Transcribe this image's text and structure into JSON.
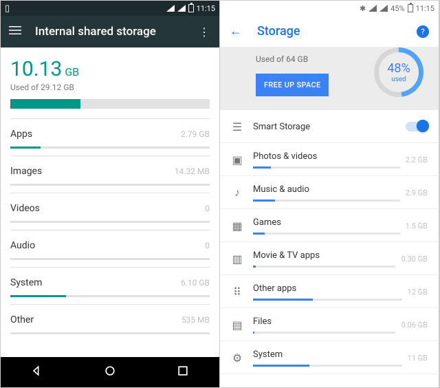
{
  "left": {
    "status_time": "11:15",
    "title": "Internal shared storage",
    "used_value": "10.13",
    "used_unit": "GB",
    "used_sub": "Used of 29.12 GB",
    "total_fill_pct": 35,
    "rows": [
      {
        "label": "Apps",
        "value": "2.79 GB",
        "fill": 15
      },
      {
        "label": "Images",
        "value": "14.32 MB",
        "fill": 0
      },
      {
        "label": "Videos",
        "value": "0",
        "fill": 0
      },
      {
        "label": "Audio",
        "value": "0",
        "fill": 0
      },
      {
        "label": "System",
        "value": "6.10 GB",
        "fill": 28
      },
      {
        "label": "Other",
        "value": "535 MB",
        "fill": 0
      }
    ]
  },
  "right": {
    "status_battery": "45%",
    "status_time": "11:15",
    "title": "Storage",
    "used_sub": "Used of 64 GB",
    "ring_pct": "48%",
    "ring_label": "used",
    "free_button": "FREE UP SPACE",
    "smart_label": "Smart Storage",
    "rows": [
      {
        "label": "Photos & videos",
        "value": "2.2 GB",
        "fill": 12
      },
      {
        "label": "Music & audio",
        "value": "2.9 GB",
        "fill": 15
      },
      {
        "label": "Games",
        "value": "1.5 GB",
        "fill": 8
      },
      {
        "label": "Movie & TV apps",
        "value": "0.30 GB",
        "fill": 2
      },
      {
        "label": "Other apps",
        "value": "12 GB",
        "fill": 40
      },
      {
        "label": "Files",
        "value": "0.06 GB",
        "fill": 1
      },
      {
        "label": "System",
        "value": "11 GB",
        "fill": 38
      }
    ]
  }
}
